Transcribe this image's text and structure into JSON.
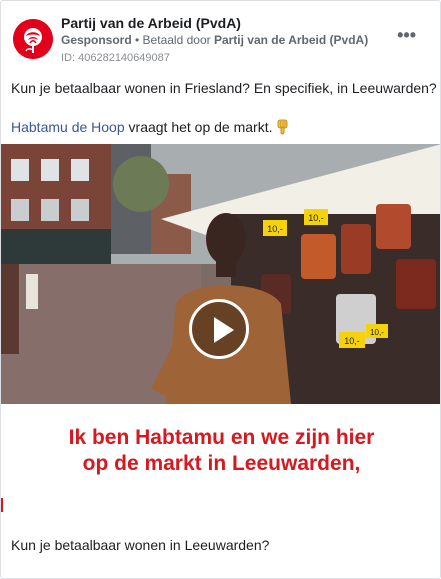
{
  "ad": {
    "page_name": "Partij van de Arbeid (PvdA)",
    "sponsored": "Gesponsord",
    "paid_by_prefix": " • Betaald door ",
    "paid_by": "Partij van de Arbeid (PvdA)",
    "id_line": "ID: 406282140649087",
    "more_icon": "more-options-icon"
  },
  "post": {
    "text_line1": "Kun je betaalbaar wonen in Friesland? En specifiek, in Leeuwarden?",
    "mention": "Habtamu de Hoop",
    "text_line2_rest": " vraagt het op de markt.",
    "emoji": "backhand-index-pointing-down"
  },
  "video": {
    "subtitle_line1": "Ik ben Habtamu en we zijn hier",
    "subtitle_line2": "op de markt in Leeuwarden,",
    "price_tags": [
      "10,-",
      "10,-",
      "10,-",
      "10,-"
    ]
  },
  "caption": "Kun je betaalbaar wonen in Leeuwarden?",
  "colors": {
    "brand_red": "#e2001a",
    "link_blue": "#385898",
    "subtitle_red": "#d6191f",
    "secondary_text": "#606770"
  }
}
